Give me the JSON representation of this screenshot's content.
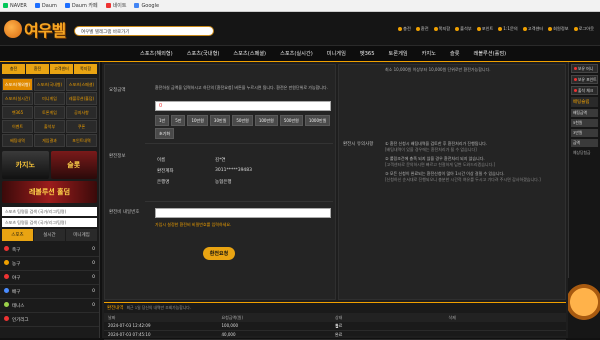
{
  "bookmarks": [
    {
      "label": "NAVER",
      "color": "#03c75a"
    },
    {
      "label": "Daum",
      "color": "#1e6fff"
    },
    {
      "label": "Daum 카페",
      "color": "#1e6fff"
    },
    {
      "label": "네이트",
      "color": "#e33"
    },
    {
      "label": "Google",
      "color": "#4285f4"
    }
  ],
  "header": {
    "logo": "여우벨",
    "search_placeholder": "여우벨 텔레그램 바로가기",
    "links": [
      "충전",
      "환전",
      "쪽지함",
      "출석부",
      "포인트",
      "1:1문의",
      "고객센터",
      "회원정보",
      "로그아웃"
    ]
  },
  "nav": [
    "스포츠(해외형)",
    "스포츠(국내형)",
    "스포츠(스페셜)",
    "스포츠(실시간)",
    "미니게임",
    "벳365",
    "토론게임",
    "카지노",
    "슬롯",
    "레볼루션(홀덤)"
  ],
  "left": {
    "quick": [
      "충전",
      "환전",
      "고객센터",
      "쪽지함"
    ],
    "menu": [
      {
        "label": "스포츠(해외형)",
        "on": true
      },
      {
        "label": "스포츠(국내형)",
        "on": false
      },
      {
        "label": "스포츠(스페셜)",
        "on": false
      },
      {
        "label": "스포츠(실시간)",
        "on": false
      },
      {
        "label": "미니게임",
        "on": false
      },
      {
        "label": "레볼루션(홀덤)",
        "on": false
      },
      {
        "label": "벳365",
        "on": false
      },
      {
        "label": "토론게임",
        "on": false
      },
      {
        "label": "공지사항",
        "on": false
      },
      {
        "label": "이벤트",
        "on": false
      },
      {
        "label": "출석부",
        "on": false
      },
      {
        "label": "쿠폰",
        "on": false
      },
      {
        "label": "베팅내역",
        "on": false
      },
      {
        "label": "게임결과",
        "on": false
      },
      {
        "label": "포인트내역",
        "on": false
      }
    ],
    "banners": [
      "카지노",
      "슬롯",
      "레볼루션 홀덤"
    ],
    "search1": "스포츠 팀명을 검색 (국가/리그/팀명)",
    "search2": "스포츠 팀명을 검색 (국가/리그/팀명)",
    "sport_tabs": [
      "스포츠",
      "실시간",
      "미니게임"
    ],
    "sports": [
      {
        "name": "축구",
        "color": "#e33",
        "count": "0"
      },
      {
        "name": "농구",
        "color": "#f0a000",
        "count": "0"
      },
      {
        "name": "야구",
        "color": "#e33",
        "count": "0"
      },
      {
        "name": "배구",
        "color": "#4a8cff",
        "count": "0"
      },
      {
        "name": "테니스",
        "color": "#9bd14a",
        "count": "0"
      },
      {
        "name": "인기리그",
        "color": "#e33",
        "count": ""
      }
    ]
  },
  "form": {
    "req_label": "요청금액",
    "notice": "환전하실 금액을 입력하시고 하단의 [환전요청] 버튼을 누르시면 됩니다. 환전은 만원단위로 가능합니다.",
    "amount": "0",
    "amounts": [
      "1만",
      "5만",
      "10만원",
      "30만원",
      "50만원",
      "100만원",
      "500만원",
      "1000만원",
      "초기화"
    ],
    "account_label": "환전정보",
    "account": [
      {
        "k": "이름",
        "v": "김*연"
      },
      {
        "k": "환전계좌",
        "v": "3011*****39483"
      },
      {
        "k": "은행명",
        "v": "농협은행"
      }
    ],
    "pw_label": "환전비 내일번호",
    "pw_hint": "가입시 설정한 환전비 비밀번호를 입력하세요.",
    "submit": "환전요청"
  },
  "rules": {
    "top": "최소 10,000원 이상부터 10,000원 단위로만 환전가능합니다.",
    "title": "환전시 유의사항",
    "items": [
      "① 환전 신청시 배팅내역을 검토한 후 환전처리가 진행됩니다.",
      "[배팅내역이 있을 경우에는 환전처리가 될 수 없습니다]",
      "② 롤링조건에 충족 되지 않을 경우 환전처리 되지 않습니다.",
      "[고객센터로 문의하시면 빠르고 친절하게 답변 도와드리겠습니다.]",
      "③ 모든 신청이 완료되는 환전신청이 많아 1시간 이상 걸릴 수 있습니다.",
      "[신청하신 순서대로 진행되오니 충분한 시간적 여유를 두시고 기다려 주시면 감사하겠습니다.]"
    ]
  },
  "history": {
    "title": "환전내역",
    "sub": "최근 1일 당신의 내역만 조회가능합니다.",
    "cols": [
      "날짜",
      "요청금액(원)",
      "상태",
      "삭제"
    ],
    "rows": [
      {
        "date": "2024-07-03 12:42:09",
        "amount": "100,000",
        "status": "완료"
      },
      {
        "date": "2024-07-03 07:45:10",
        "amount": "40,000",
        "status": "완료"
      }
    ],
    "page": "1"
  },
  "right": {
    "buttons": [
      "보유 머니",
      "보유 포인트",
      "출석 체크"
    ],
    "bet_title": "배팅슬립",
    "bet_items": [
      "배팅금액",
      "5천원",
      "3만원",
      "금액"
    ],
    "notice_label": "예상당첨금"
  }
}
